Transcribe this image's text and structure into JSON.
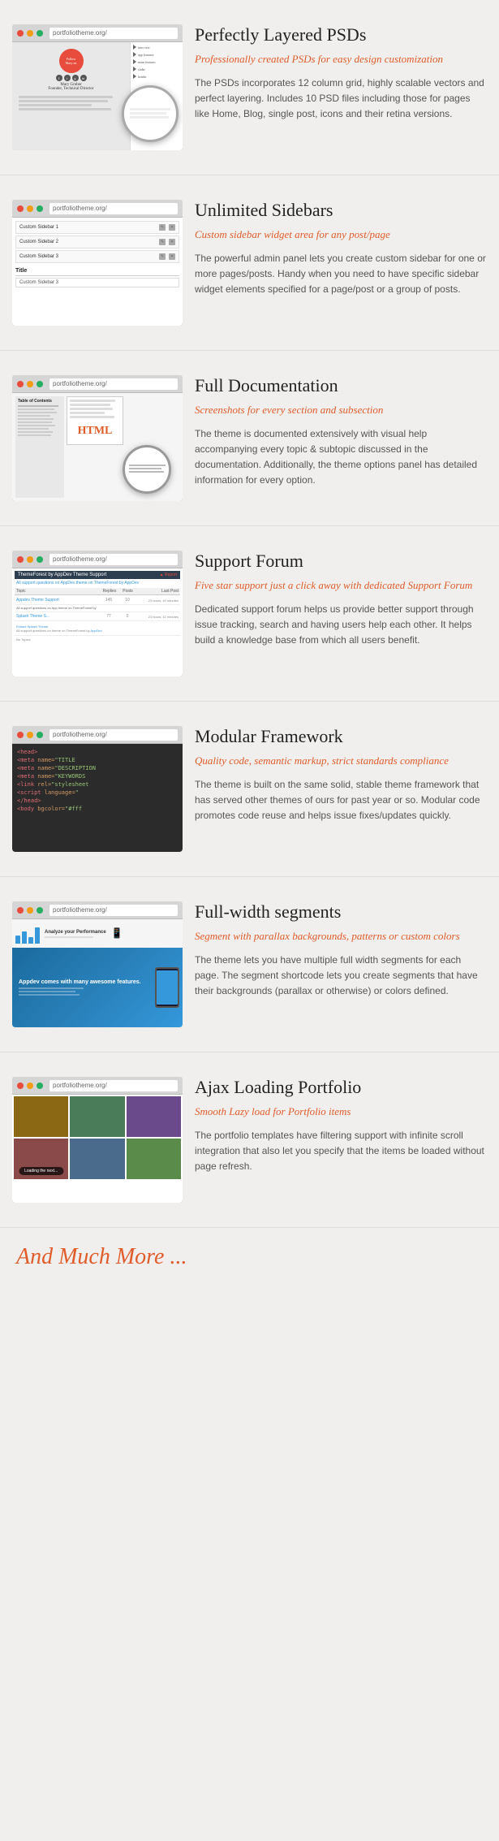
{
  "sections": [
    {
      "id": "psd",
      "title": "Perfectly Layered PSDs",
      "subtitle": "Professionally created PSDs for easy design customization",
      "description": "The PSDs incorporates 12 column grid, highly scalable vectors and perfect layering. Includes 10 PSD files including those for pages like Home, Blog, single post, icons and their retina versions.",
      "browser_url": "portfoliotheme.org/"
    },
    {
      "id": "sidebars",
      "title": "Unlimited Sidebars",
      "subtitle": "Custom sidebar widget area for any post/page",
      "description": "The powerful admin panel lets you create custom sidebar for one or more pages/posts. Handy when you need to have specific sidebar widget elements specified for a page/post or a group of posts.",
      "browser_url": "portfoliotheme.org/",
      "sidebar_items": [
        "Custom Sidebar 1",
        "Custom Sidebar 2",
        "Custom Sidebar 3"
      ],
      "sidebar_title_label": "Title",
      "sidebar_title_value": "Custom Sidebar 3"
    },
    {
      "id": "documentation",
      "title": "Full Documentation",
      "subtitle": "Screenshots for every section and subsection",
      "description": "The theme is documented extensively with visual help accompanying every topic & subtopic discussed in the documentation. Additionally, the theme options panel has detailed information for every option.",
      "browser_url": "portfoliotheme.org/"
    },
    {
      "id": "support",
      "title": "Support Forum",
      "subtitle": "Five star support just a click away with dedicated Support Forum",
      "description": "Dedicated support forum helps us provide better support through issue tracking, search and having users help each other. It helps build a knowledge base from which all users benefit.",
      "browser_url": "portfoliotheme.org/",
      "forum_title": "ThemeForest by AppDev Theme Support",
      "forum_subtitle": "All support questions on AppDev theme on ThemeForest by AppDev",
      "forum_rows": [
        {
          "label": "Appdev Theme Support",
          "count1": "149",
          "count2": "10",
          "time": "23 hours, 40 minutes"
        },
        {
          "label": "Splash Theme S...",
          "count1": "77",
          "count2": "0",
          "time": "23 hours, 42 minutes"
        }
      ]
    },
    {
      "id": "framework",
      "title": "Modular Framework",
      "subtitle": "Quality code, semantic markup, strict standards compliance",
      "description": "The theme is built on the same solid, stable theme framework that has served other themes of ours for past year or so. Modular code promotes code reuse and helps issue fixes/updates quickly.",
      "browser_url": "portfoliotheme.org/",
      "code_lines": [
        "<head>",
        "  <meta name=\"TITLE",
        "  <meta name=\"DESCRIPTION",
        "  <meta name=\"KEYWORDS",
        "  <link rel=\"stylesheet\"",
        "  <script language=\"",
        "</head>",
        "<body bgcolor=\"#fff"
      ]
    },
    {
      "id": "segments",
      "title": "Full-width segments",
      "subtitle": "Segment with parallax backgrounds, patterns or custom colors",
      "description": "The theme lets you have multiple full width segments for each page. The segment shortcode lets you create segments that have their backgrounds (parallax or otherwise) or colors defined.",
      "browser_url": "portfoliotheme.org/",
      "segment_label": "Analyze your Performance",
      "segment_desc": "Appdev comes with many awesome features."
    },
    {
      "id": "portfolio",
      "title": "Ajax Loading Portfolio",
      "subtitle": "Smooth  Lazy load for Portfolio items",
      "description": "The portfolio templates have filtering support with infinite scroll integration that also let you specify that the items be loaded without page refresh.",
      "browser_url": "portfoliotheme.org/",
      "loading_text": "Loading the next..."
    }
  ],
  "much_more": {
    "label": "And Much More ..."
  }
}
